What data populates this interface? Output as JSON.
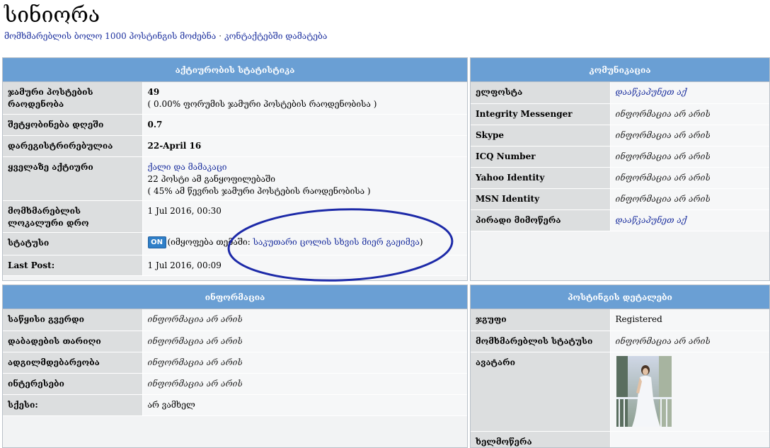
{
  "header": {
    "username": "სინიორა",
    "links": [
      "მომხმარებლის ბოლო 1000 პოსტინგის მოძებნა",
      "კონტაქტებში დამატება"
    ],
    "separator": "·"
  },
  "activity": {
    "title": "აქტიურობის სტატისტიკა",
    "rows": [
      {
        "label": "ჯამური პოსტების რაოდენობა",
        "value": "49",
        "note": "( 0.00% ფორუმის ჯამური პოსტების რაოდენობისა )"
      },
      {
        "label": "შეტყობინება დღეში",
        "value": "0.7"
      },
      {
        "label": "დარეგისტრირებულია",
        "value": "22-April 16"
      },
      {
        "label": "ყველაზე აქტიური",
        "value": "ქალი და მამაკაცი",
        "line2": "22 პოსტი ამ განყოფილებაში",
        "line3": "( 45% ამ წევრის ჯამური პოსტების რაოდენობისა )"
      },
      {
        "label": "მომხმარებლის ლოკალური დრო",
        "value": "1 Jul 2016, 00:30"
      },
      {
        "label": "სტატუსი",
        "badge": "ON",
        "prefix": "(იმყოფება თემაში:",
        "topic": "საკუთარი ცოლის სხვის მიერ გაჟიმვა",
        "suffix": ")"
      },
      {
        "label": "Last Post:",
        "value": "1 Jul 2016, 00:09"
      }
    ]
  },
  "communication": {
    "title": "კომუნიკაცია",
    "rows": [
      {
        "label": "ელფოსტა",
        "value": "დააწკაპუნეთ აქ",
        "link": true
      },
      {
        "label": "Integrity Messenger",
        "value": "ინფორმაცია არ არის"
      },
      {
        "label": "Skype",
        "value": "ინფორმაცია არ არის"
      },
      {
        "label": "ICQ Number",
        "value": "ინფორმაცია არ არის"
      },
      {
        "label": "Yahoo Identity",
        "value": "ინფორმაცია არ არის"
      },
      {
        "label": "MSN Identity",
        "value": "ინფორმაცია არ არის"
      },
      {
        "label": "პირადი მიმოწერა",
        "value": "დააწკაპუნეთ აქ",
        "link": true
      }
    ]
  },
  "information": {
    "title": "ინფორმაცია",
    "rows": [
      {
        "label": "საწყისი გვერდი",
        "value": "ინფორმაცია არ არის"
      },
      {
        "label": "დაბადების თარიღი",
        "value": "ინფორმაცია არ არის"
      },
      {
        "label": "ადგილმდებარეობა",
        "value": "ინფორმაცია არ არის"
      },
      {
        "label": "ინტერესები",
        "value": "ინფორმაცია არ არის"
      },
      {
        "label": "სქესი:",
        "value": "არ ვამხელ",
        "plain": true
      }
    ]
  },
  "posting": {
    "title": "პოსტინგის დეტალები",
    "rows": [
      {
        "label": "ჯგუფი",
        "value": "Registered",
        "plain": true
      },
      {
        "label": "მომხმარებლის სტატუსი",
        "value": "ინფორმაცია არ არის"
      },
      {
        "label": "ავატარი"
      },
      {
        "label": "ხელმოწერა"
      }
    ]
  },
  "colors": {
    "header_bar": "#6a9fd4",
    "label_cell": "#dcdedf",
    "value_cell": "#f6f7f8",
    "link": "#1b2f9e",
    "annotation": "#1d2aa8"
  }
}
